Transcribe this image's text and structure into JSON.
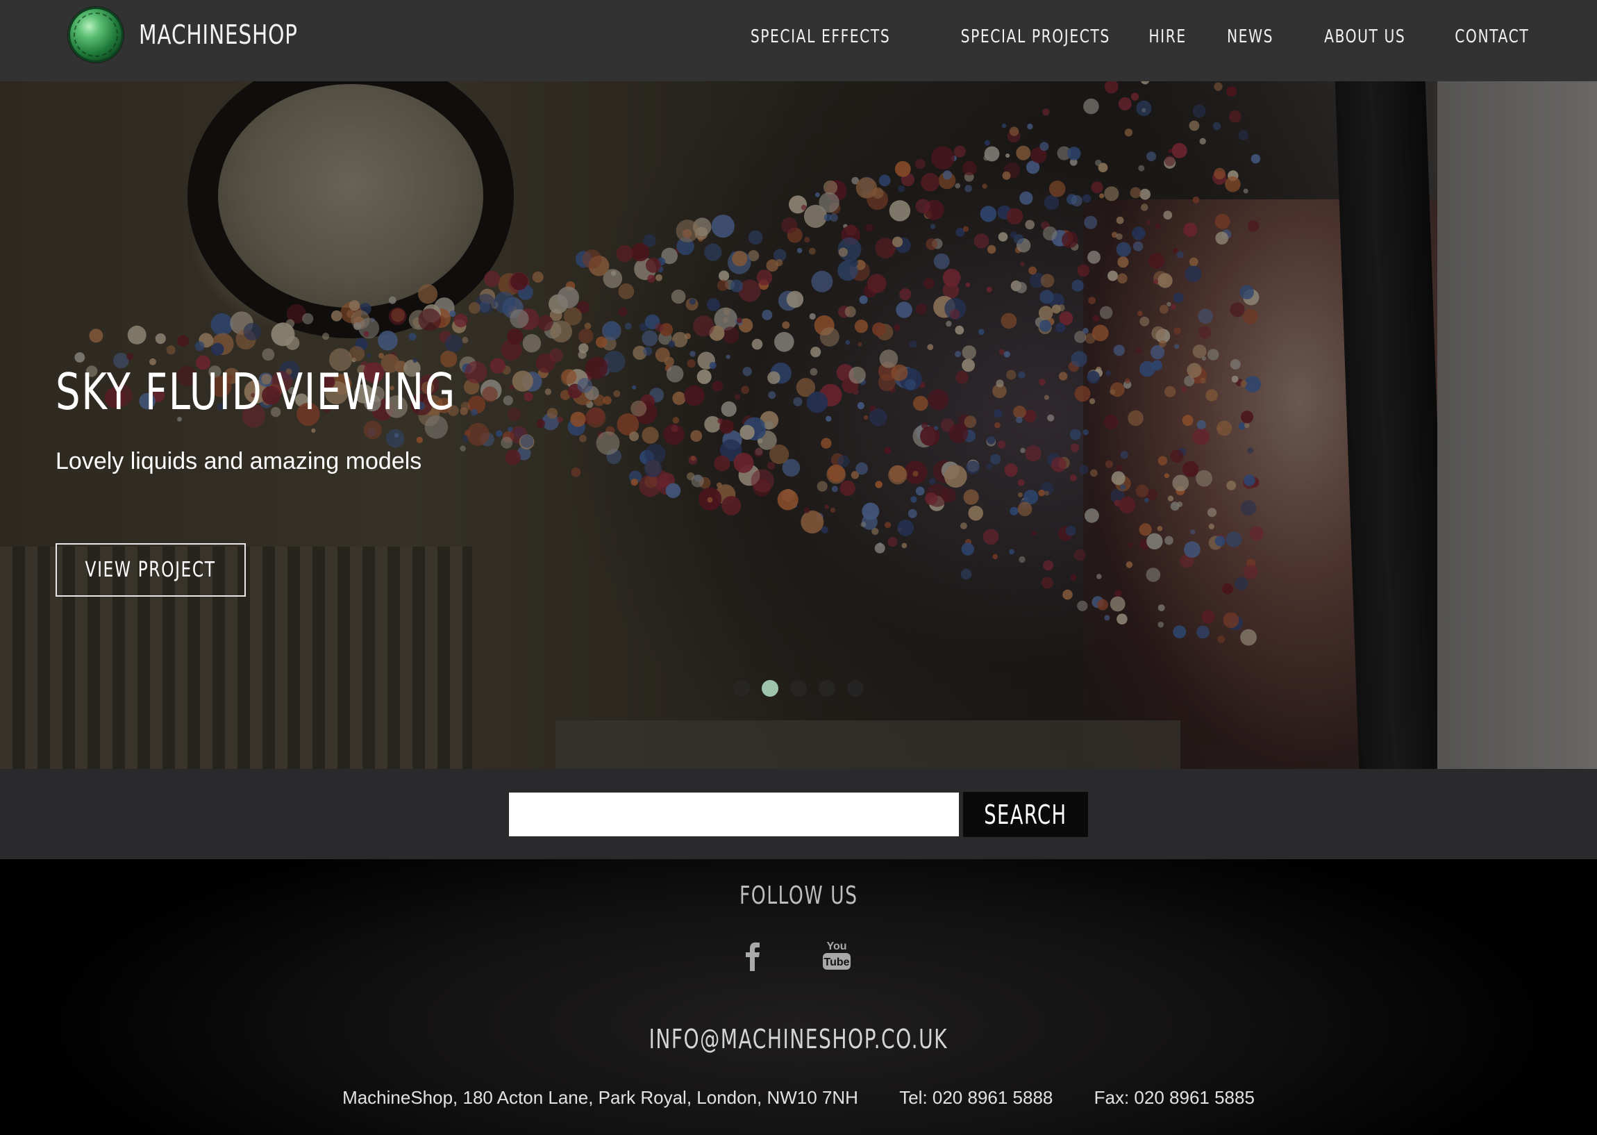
{
  "header": {
    "brand": "MACHINESHOP",
    "nav": [
      {
        "label": "SPECIAL EFFECTS"
      },
      {
        "label": "SPECIAL PROJECTS"
      },
      {
        "label": "HIRE"
      },
      {
        "label": "NEWS"
      },
      {
        "label": "ABOUT US"
      },
      {
        "label": "CONTACT"
      }
    ]
  },
  "hero": {
    "title": "SKY FLUID VIEWING",
    "subtitle": "Lovely liquids and amazing models",
    "button_label": "VIEW PROJECT",
    "slides_count": 5,
    "active_slide": 2
  },
  "search": {
    "value": "",
    "placeholder": "",
    "button_label": "SEARCH"
  },
  "footer": {
    "follow_label": "FOLLOW US",
    "social": [
      {
        "name": "facebook-icon"
      },
      {
        "name": "youtube-icon"
      }
    ],
    "email": "INFO@MACHINESHOP.CO.UK",
    "address": "MachineShop, 180 Acton Lane, Park Royal, London, NW10 7NH",
    "tel": "Tel: 020 8961 5888",
    "fax": "Fax: 020 8961 5885"
  },
  "colors": {
    "header_bg": "#323232",
    "search_band_bg": "#2a292b",
    "active_dot": "#9fc4ae",
    "logo_green": "#1f7a3a"
  }
}
